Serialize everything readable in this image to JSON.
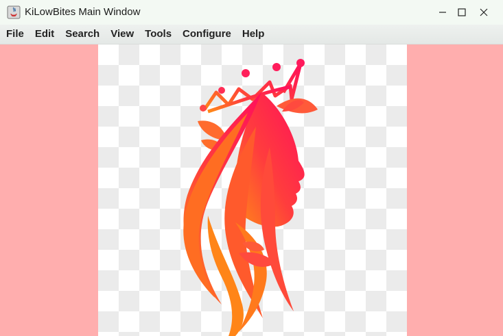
{
  "window": {
    "title": "KiLowBites Main Window",
    "controls": [
      "minimize",
      "maximize",
      "close"
    ]
  },
  "menu": [
    "File",
    "Edit",
    "Search",
    "View",
    "Tools",
    "Configure",
    "Help"
  ],
  "canvas": {
    "background_color": "#ffaeae",
    "image": {
      "description_icon": "woman-silhouette-crown-logo-icon",
      "transparency_pattern": "checkerboard",
      "gradient_colors": [
        "#ff0f57",
        "#ff7a1c"
      ]
    }
  }
}
